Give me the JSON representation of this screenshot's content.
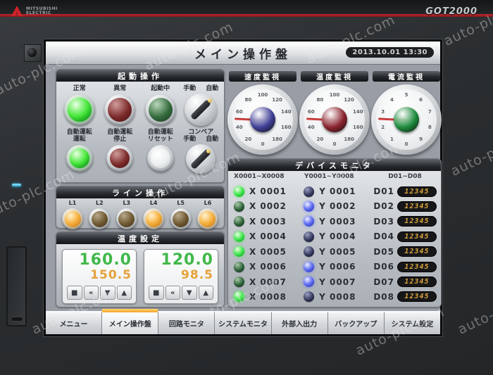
{
  "watermark": {
    "text": "auto-plc.com"
  },
  "bezel": {
    "brand_top": "MITSUBISHI",
    "brand_bottom": "ELECTRIC",
    "model": "GOT2000"
  },
  "titlebar": {
    "title": "メイン操作盤",
    "datetime": "2013.10.01 13:30"
  },
  "startup": {
    "title": "起動操作",
    "row1": [
      {
        "label": "正常",
        "color": "green",
        "state": "on"
      },
      {
        "label": "異常",
        "color": "red",
        "state": "off"
      },
      {
        "label": "起動中",
        "color": "green",
        "state": "off"
      },
      {
        "label_left": "手動",
        "label_right": "自動"
      }
    ],
    "row2": [
      {
        "label1": "自動運転",
        "label2": "運転",
        "color": "green",
        "state": "on"
      },
      {
        "label1": "自動運転",
        "label2": "停止",
        "color": "red",
        "state": "off"
      },
      {
        "label1": "自動運転",
        "label2": "リセット",
        "color": "white",
        "state": "off"
      },
      {
        "label1": "コンベア",
        "label_left": "手動",
        "label_right": "自動"
      }
    ]
  },
  "line_panel": {
    "title": "ライン操作",
    "lamps": [
      {
        "label": "L1",
        "state": "on"
      },
      {
        "label": "L2",
        "state": "off"
      },
      {
        "label": "L3",
        "state": "off"
      },
      {
        "label": "L4",
        "state": "on"
      },
      {
        "label": "L5",
        "state": "off"
      },
      {
        "label": "L6",
        "state": "on"
      }
    ]
  },
  "temp_panel": {
    "title": "温度設定",
    "controllers": [
      {
        "pv": "160.0",
        "sv": "150.5",
        "btn_stop": "■",
        "btn_fast": "«",
        "btn_down": "▼",
        "btn_up": "▲"
      },
      {
        "pv": "120.0",
        "sv": "98.5",
        "btn_stop": "■",
        "btn_fast": "«",
        "btn_down": "▼",
        "btn_up": "▲"
      }
    ]
  },
  "gauges": {
    "items": [
      {
        "title": "速度監視",
        "ticks": [
          "0",
          "20",
          "40",
          "60",
          "80",
          "100",
          "120",
          "140",
          "160",
          "180"
        ],
        "center_color": "#3f3f96",
        "needle_deg": 183
      },
      {
        "title": "温度監視",
        "ticks": [
          "0",
          "20",
          "40",
          "60",
          "80",
          "100",
          "120",
          "140",
          "160",
          "180"
        ],
        "center_color": "#8a242e",
        "needle_deg": 183
      },
      {
        "title": "電流監視",
        "ticks": [
          "0",
          "1",
          "2",
          "3",
          "4",
          "5",
          "6",
          "7",
          "8",
          "9"
        ],
        "center_color": "#1d8a3c",
        "needle_deg": 183
      }
    ]
  },
  "device_monitor": {
    "title": "デバイスモニタ",
    "col_headers": [
      "X0001~X0008",
      "Y0001~Y0008",
      "D01~D08"
    ],
    "rows": [
      {
        "x_label": "X 0001",
        "x_state": "on",
        "y_label": "Y 0001",
        "y_state": "off",
        "d_label": "D01",
        "d_value": "12345"
      },
      {
        "x_label": "X 0002",
        "x_state": "off",
        "y_label": "Y 0002",
        "y_state": "on",
        "d_label": "D02",
        "d_value": "12345"
      },
      {
        "x_label": "X 0003",
        "x_state": "off",
        "y_label": "Y 0003",
        "y_state": "on",
        "d_label": "D03",
        "d_value": "12345"
      },
      {
        "x_label": "X 0004",
        "x_state": "on",
        "y_label": "Y 0004",
        "y_state": "off",
        "d_label": "D04",
        "d_value": "12345"
      },
      {
        "x_label": "X 0005",
        "x_state": "on",
        "y_label": "Y 0005",
        "y_state": "off",
        "d_label": "D05",
        "d_value": "12345"
      },
      {
        "x_label": "X 0006",
        "x_state": "off",
        "y_label": "Y 0006",
        "y_state": "on",
        "d_label": "D06",
        "d_value": "12345"
      },
      {
        "x_label": "X 0007",
        "x_state": "off",
        "y_label": "Y 0007",
        "y_state": "on",
        "d_label": "D07",
        "d_value": "12345"
      },
      {
        "x_label": "X 0008",
        "x_state": "on",
        "y_label": "Y 0008",
        "y_state": "off",
        "d_label": "D08",
        "d_value": "12345"
      }
    ]
  },
  "tabs": {
    "active_index": 1,
    "items": [
      {
        "label": "メニュー"
      },
      {
        "label": "メイン操作盤"
      },
      {
        "label": "回路モニタ"
      },
      {
        "label": "システムモニタ"
      },
      {
        "label": "外部入出力"
      },
      {
        "label": "バックアップ"
      },
      {
        "label": "システム設定"
      }
    ]
  }
}
